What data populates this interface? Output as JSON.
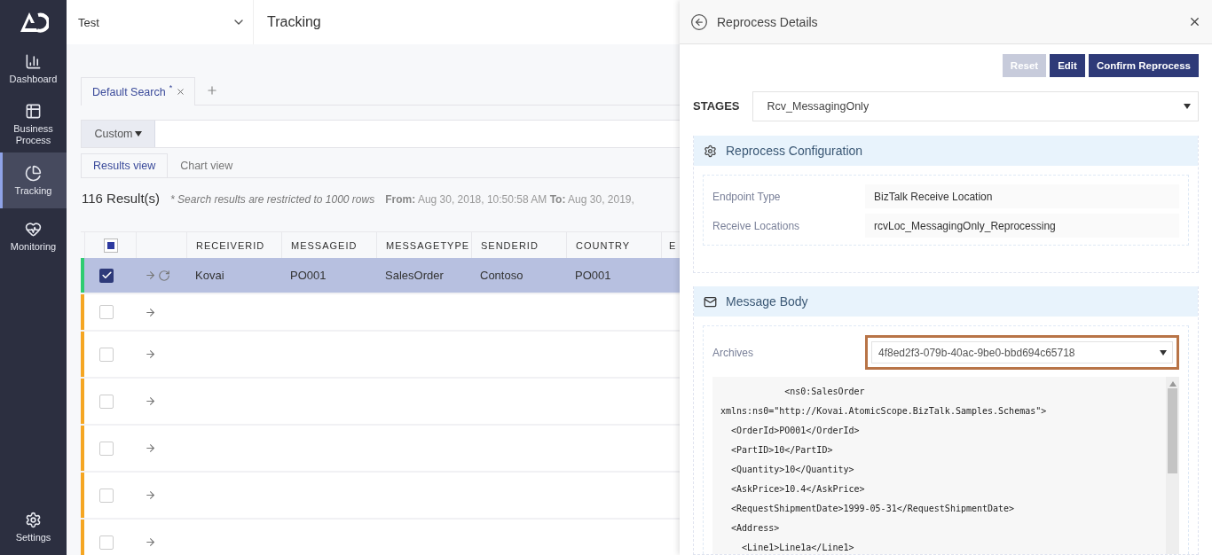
{
  "sidebar": {
    "items": [
      {
        "label": "Dashboard",
        "selected": false
      },
      {
        "label": "Business Process",
        "selected": false
      },
      {
        "label": "Tracking",
        "selected": true
      },
      {
        "label": "Monitoring",
        "selected": false
      }
    ],
    "settings": {
      "label": "Settings"
    }
  },
  "top_bar": {
    "environment": "Test",
    "page_title": "Tracking"
  },
  "search_tabs": [
    {
      "label": "Default Search",
      "modified_mark": "*",
      "selected": true
    }
  ],
  "filter": {
    "label": "Custom"
  },
  "view_tabs": [
    {
      "label": "Results view",
      "selected": true
    },
    {
      "label": "Chart view",
      "selected": false
    }
  ],
  "results": {
    "count": "116 Result(s)",
    "note": "* Search results are restricted to 1000 rows",
    "range": "**From:** Aug 30, 2018, 10:50:58 AM **To:** Aug 30, 2019,"
  },
  "table": {
    "select_all_partial": true,
    "columns": [
      "RECEIVERID",
      "MESSAGEID",
      "MESSAGETYPE",
      "SENDERID",
      "COUNTRY",
      "E"
    ],
    "rows": [
      {
        "color": "#2ecc71",
        "selected": true,
        "checked": true,
        "reprocessed": true,
        "cells": [
          "Kovai",
          "PO001",
          "SalesOrder",
          "Contoso",
          "PO001"
        ]
      },
      {
        "color": "#f5a623",
        "selected": false,
        "checked": false,
        "reprocessed": false
      },
      {
        "color": "#f5a623",
        "selected": false,
        "checked": false,
        "reprocessed": false
      },
      {
        "color": "#f5a623",
        "selected": false,
        "checked": false,
        "reprocessed": false
      },
      {
        "color": "#f5a623",
        "selected": false,
        "checked": false,
        "reprocessed": false
      },
      {
        "color": "#f5a623",
        "selected": false,
        "checked": false,
        "reprocessed": false
      },
      {
        "color": "#f5a623",
        "selected": false,
        "checked": false,
        "reprocessed": false
      }
    ]
  },
  "panel": {
    "title": "Reprocess Details",
    "buttons": [
      {
        "label": "Reset",
        "disabled": true
      },
      {
        "label": "Edit",
        "disabled": false
      },
      {
        "label": "Confirm Reprocess",
        "disabled": false
      }
    ],
    "stages": {
      "label": "STAGES",
      "value": "Rcv_MessagingOnly"
    },
    "config": {
      "title": "Reprocess Configuration",
      "fields": [
        {
          "label": "Endpoint Type",
          "value": "BizTalk Receive Location"
        },
        {
          "label": "Receive Locations",
          "value": "rcvLoc_MessagingOnly_Reprocessing"
        }
      ]
    },
    "message_body": {
      "title": "Message Body",
      "archives": {
        "label": "Archives",
        "value": "4f8ed2f3-079b-40ac-9be0-bbd694c65718",
        "highlighted": true
      },
      "lines": [
        "            <ns0:SalesOrder",
        "xmlns:ns0=\"http://Kovai.AtomicScope.BizTalk.Samples.Schemas\">",
        "  <OrderId>PO001</OrderId>",
        "  <PartID>10</PartID>",
        "  <Quantity>10</Quantity>",
        "  <AskPrice>10.4</AskPrice>",
        "  <RequestShipmentDate>1999-05-31</RequestShipmentDate>",
        "  <Address>",
        "    <Line1>Line1a</Line1>"
      ]
    }
  }
}
